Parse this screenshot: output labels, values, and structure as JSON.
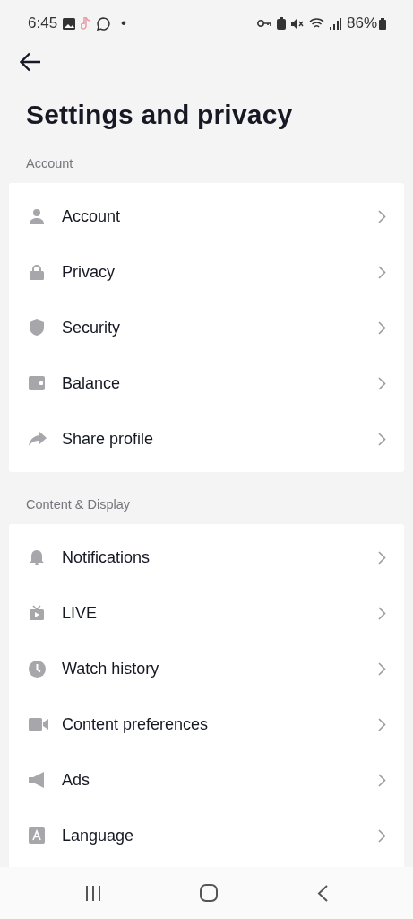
{
  "status_bar": {
    "time": "6:45",
    "dot": "•",
    "battery": "86%"
  },
  "title": "Settings and privacy",
  "sections": [
    {
      "label": "Account",
      "items": [
        {
          "label": "Account"
        },
        {
          "label": "Privacy"
        },
        {
          "label": "Security"
        },
        {
          "label": "Balance"
        },
        {
          "label": "Share profile"
        }
      ]
    },
    {
      "label": "Content & Display",
      "items": [
        {
          "label": "Notifications"
        },
        {
          "label": "LIVE"
        },
        {
          "label": "Watch history"
        },
        {
          "label": "Content preferences"
        },
        {
          "label": "Ads"
        },
        {
          "label": "Language"
        }
      ]
    }
  ]
}
